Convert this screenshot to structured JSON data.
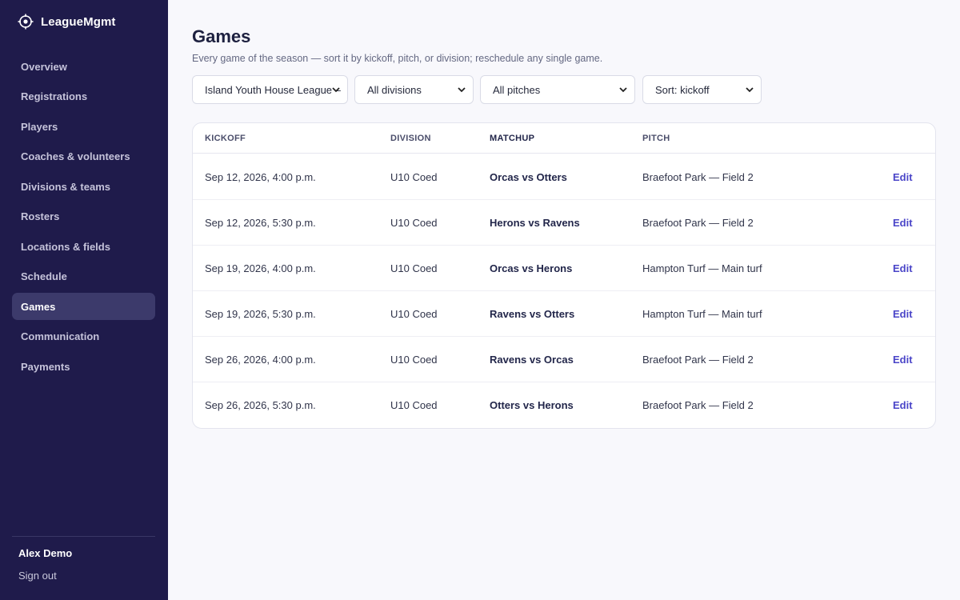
{
  "app": {
    "name": "LeagueMgmt",
    "logo_icon": "crosshair-icon"
  },
  "sidebar": {
    "items": [
      {
        "label": "Overview",
        "active": false
      },
      {
        "label": "Registrations",
        "active": false
      },
      {
        "label": "Players",
        "active": false
      },
      {
        "label": "Coaches & volunteers",
        "active": false
      },
      {
        "label": "Divisions & teams",
        "active": false
      },
      {
        "label": "Rosters",
        "active": false
      },
      {
        "label": "Locations & fields",
        "active": false
      },
      {
        "label": "Schedule",
        "active": false
      },
      {
        "label": "Games",
        "active": true
      },
      {
        "label": "Communication",
        "active": false
      },
      {
        "label": "Payments",
        "active": false
      }
    ],
    "user": {
      "name": "Alex Demo",
      "sign_out": "Sign out"
    }
  },
  "page": {
    "title": "Games",
    "subtitle": "Every game of the season — sort it by kickoff, pitch, or division; reschedule any single game."
  },
  "filters": {
    "season": "Island Youth House League –",
    "division": "All divisions",
    "pitch": "All pitches",
    "sort": "Sort: kickoff"
  },
  "table": {
    "headers": {
      "kickoff": "KICKOFF",
      "division": "DIVISION",
      "matchup": "MATCHUP",
      "pitch": "PITCH"
    },
    "rows": [
      {
        "kickoff": "Sep 12, 2026, 4:00 p.m.",
        "division": "U10 Coed",
        "matchup": "Orcas vs Otters",
        "pitch": "Braefoot Park — Field 2",
        "action": "Edit"
      },
      {
        "kickoff": "Sep 12, 2026, 5:30 p.m.",
        "division": "U10 Coed",
        "matchup": "Herons vs Ravens",
        "pitch": "Braefoot Park — Field 2",
        "action": "Edit"
      },
      {
        "kickoff": "Sep 19, 2026, 4:00 p.m.",
        "division": "U10 Coed",
        "matchup": "Orcas vs Herons",
        "pitch": "Hampton Turf — Main turf",
        "action": "Edit"
      },
      {
        "kickoff": "Sep 19, 2026, 5:30 p.m.",
        "division": "U10 Coed",
        "matchup": "Ravens vs Otters",
        "pitch": "Hampton Turf — Main turf",
        "action": "Edit"
      },
      {
        "kickoff": "Sep 26, 2026, 4:00 p.m.",
        "division": "U10 Coed",
        "matchup": "Ravens vs Orcas",
        "pitch": "Braefoot Park — Field 2",
        "action": "Edit"
      },
      {
        "kickoff": "Sep 26, 2026, 5:30 p.m.",
        "division": "U10 Coed",
        "matchup": "Otters vs Herons",
        "pitch": "Braefoot Park — Field 2",
        "action": "Edit"
      }
    ]
  },
  "colors": {
    "sidebar_bg": "#1f1b4b",
    "sidebar_active": "#3c3a6b",
    "accent": "#4a45c8",
    "page_bg": "#f8f8fc"
  }
}
